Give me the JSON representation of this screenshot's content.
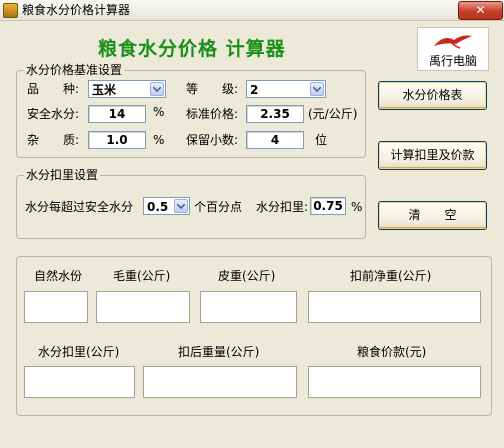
{
  "window": {
    "title": "粮食水分价格计算器",
    "close": "✕"
  },
  "header": {
    "app_title": "粮食水分价格  计算器",
    "logo_text": "禹行电脑"
  },
  "base": {
    "legend": "水分价格基准设置",
    "variety_label": "品　　种:",
    "variety_value": "玉米",
    "grade_label": "等　　级:",
    "grade_value": "2",
    "safe_moisture_label": "安全水分:",
    "safe_moisture_value": "14",
    "safe_moisture_unit": "%",
    "std_price_label": "标准价格:",
    "std_price_value": "2.35",
    "std_price_unit": "(元/公斤)",
    "impurity_label": "杂　　质:",
    "impurity_value": "1.0",
    "impurity_unit": "%",
    "decimals_label": "保留小数:",
    "decimals_value": "4",
    "decimals_unit": "位"
  },
  "deduction": {
    "legend": "水分扣里设置",
    "exceed_label": "水分每超过安全水分",
    "exceed_value": "0.5",
    "exceed_unit": "个百分点",
    "deduct_label": "水分扣里:",
    "deduct_value": "0.75",
    "deduct_unit": "%"
  },
  "buttons": {
    "price_table": "水分价格表",
    "calculate": "计算扣里及价款",
    "clear": "清　　空"
  },
  "results": {
    "natural_moisture": "自然水份",
    "gross_weight": "毛重(公斤)",
    "tare_weight": "皮重(公斤)",
    "net_before": "扣前净重(公斤)",
    "moisture_deduction": "水分扣里(公斤)",
    "weight_after": "扣后重量(公斤)",
    "grain_payment": "粮食价款(元)"
  }
}
